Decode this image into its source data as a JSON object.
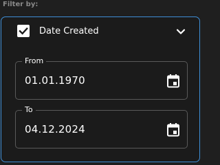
{
  "filter": {
    "label": "Filter by:"
  },
  "date_filter": {
    "checkbox_checked": true,
    "title": "Date Created",
    "from": {
      "label": "From",
      "value": "01.01.1970",
      "icon": "calendar-icon"
    },
    "to": {
      "label": "To",
      "value": "04.12.2024",
      "icon": "calendar-icon"
    }
  },
  "colors": {
    "accent_border": "#3f8fd8",
    "background": "#1f1f1f",
    "field_border": "#5a5a5a",
    "label_muted": "#8a8a8a"
  }
}
